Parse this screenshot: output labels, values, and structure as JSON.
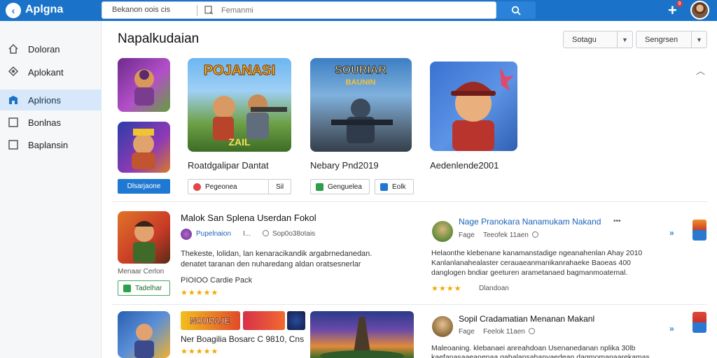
{
  "app": {
    "logo_glyph": "‹",
    "title": "Aplgna"
  },
  "search": {
    "tag_label": "Bekanon oois cis",
    "placeholder": "Femanmi",
    "button_icon": "search-icon"
  },
  "header": {
    "notification_count": "9",
    "add_icon": "plus-icon"
  },
  "sidebar": {
    "items": [
      {
        "label": "Doloran",
        "icon": "home-icon",
        "active": false
      },
      {
        "label": "Aplokant",
        "icon": "puzzle-icon",
        "active": false
      },
      {
        "label": "Aplrions",
        "icon": "store-icon",
        "active": true
      },
      {
        "label": "Bonlnas",
        "icon": "square-icon",
        "active": false
      },
      {
        "label": "Baplansin",
        "icon": "square-icon",
        "active": false
      }
    ]
  },
  "main": {
    "title": "Napalkudaian",
    "sort_dropdown": "Sotagu",
    "filter_dropdown": "Sengrsen",
    "featured": {
      "thumb_texts": [
        "POJANASI",
        "ZAIL",
        "SOURIAR",
        "BAUNIN"
      ],
      "items": [
        {
          "label": "",
          "button": "Dlsarjaone"
        },
        {
          "label": "Roatdgalipar Dantat",
          "button": "Pegeonea",
          "button_extra": "Sil"
        },
        {
          "label": "Nebary Pnd2019",
          "button": "Genguelea"
        },
        {
          "label": "Aedenlende2001",
          "button": "Eolk"
        }
      ]
    },
    "list": [
      {
        "title": "Malok San Splena Userdan Fokol",
        "author": "Pupelnaion",
        "time": "Sop0o38otais",
        "separator": "I...",
        "caption": "Menaar Cerlon",
        "button": "Tadelhar",
        "desc": [
          "Thekeste, lolidan, lan kenaracikandik argabrnedanedan.",
          "denatet taranan den nuharedang aldan oratsesnerlar",
          "PIOIOO Cardie Pack"
        ],
        "stars": "★★★★★"
      },
      {
        "title": "Nage Pranokara Nanamukam Nakand",
        "author": "Fage",
        "time": "Teeofek 11aen",
        "extra": "•••",
        "desc": [
          "Helaonthe klebenane kanamanstadige ngeanahenlan Ahay 2010",
          "Kanlanlanahealaster cerauaeanmanikanrahaeke Baoeas 400",
          "danglogen bndiar geeturen arametanaed bagmanmoatemal."
        ],
        "stars_text": "Dlandoan",
        "stars": "★★★★"
      },
      {
        "title": "Sopil Cradamatian Menanan Makanl",
        "author": "Fage",
        "time": "Feelok 11aen",
        "desc": [
          "Maleoaning. klebanaei anreahdoan Usenanedanan nplika 30lb",
          "kaefanasaaeanenaa gabalansahanyaedean dagmomanaarekamas"
        ]
      }
    ],
    "lower_row": {
      "label": "Ner Boagilia Bosarc C 9810, Cns",
      "thumb_texts": [
        "NOUPAJE",
        "",
        ""
      ],
      "stars": "★★★★★"
    }
  },
  "colors": {
    "accent": "#1a73c9",
    "star": "#f2a900",
    "active_nav": "#d7e8fa"
  }
}
